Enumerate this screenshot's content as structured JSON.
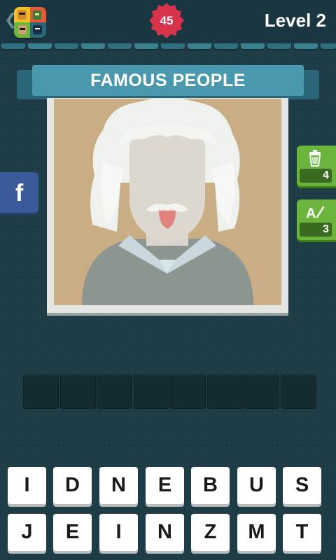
{
  "header": {
    "coins": "45",
    "level": "Level 2",
    "back_icon": "chevron-left-icon"
  },
  "category": {
    "title": "FAMOUS PEOPLE"
  },
  "hints": [
    {
      "icon": "trash-icon",
      "count": "4"
    },
    {
      "icon": "reveal-letter-icon",
      "count": "3"
    }
  ],
  "social": {
    "facebook_label": "f"
  },
  "answer": {
    "slot_count": 8,
    "slots": [
      "",
      "",
      "",
      "",
      "",
      "",
      "",
      ""
    ]
  },
  "keyboard": {
    "row1": [
      "I",
      "D",
      "N",
      "E",
      "B",
      "U",
      "S"
    ],
    "row2": [
      "J",
      "E",
      "I",
      "N",
      "Z",
      "M",
      "T"
    ]
  },
  "colors": {
    "background": "#1d3c46",
    "banner": "#4a98ad",
    "coin_badge": "#d8334a",
    "hint_green": "#6bb53c",
    "facebook_blue": "#3b5a9a"
  }
}
